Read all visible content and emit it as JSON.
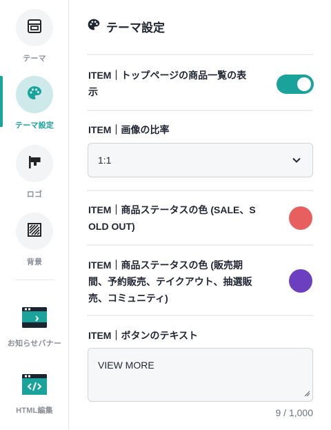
{
  "sidebar": {
    "items": [
      {
        "label": "テーマ",
        "icon": "layout-icon"
      },
      {
        "label": "テーマ設定",
        "icon": "palette-icon",
        "active": true
      },
      {
        "label": "ロゴ",
        "icon": "signboard-icon"
      },
      {
        "label": "背景",
        "icon": "hatched-square-icon"
      },
      {
        "label": "お知らせバナー",
        "icon": "banner-window-icon"
      },
      {
        "label": "HTML編集",
        "icon": "code-window-icon"
      }
    ]
  },
  "header": {
    "title": "テーマ設定",
    "icon": "palette-icon"
  },
  "settings": {
    "top_list": {
      "label": "ITEM｜トップページの商品一覧の表示",
      "line1": "ITEM｜トップページの商品一覧の表",
      "line2": "示",
      "enabled": true
    },
    "image_ratio": {
      "label": "ITEM｜画像の比率",
      "value": "1:1"
    },
    "status_color": {
      "line1": "ITEM｜商品ステータスの色 (SALE、S",
      "line2": "OLD OUT)",
      "color": "#e85f5f"
    },
    "status_color2": {
      "line1": "ITEM｜商品ステータスの色 (販売期",
      "line2": "間、予約販売、テイクアウト、抽選販",
      "line3": "売、コミュニティ)",
      "color": "#6b3fc0"
    },
    "button_text": {
      "label": "ITEM｜ボタンのテキスト",
      "value": "VIEW MORE",
      "counter": "9 / 1,000"
    }
  },
  "colors": {
    "accent": "#1aa39a",
    "muted": "#8a8f99"
  }
}
